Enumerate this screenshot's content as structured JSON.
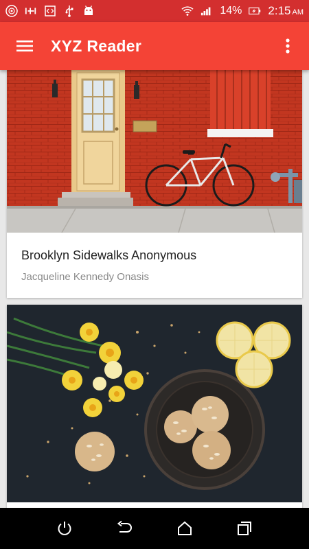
{
  "status_bar": {
    "battery_percent": "14%",
    "time": "2:15",
    "ampm": "AM",
    "icons": [
      "app-badge-icon",
      "signal-bars-icon",
      "code-icon",
      "usb-icon",
      "android-icon",
      "wifi-icon",
      "cell-signal-icon",
      "battery-charging-icon"
    ]
  },
  "app_bar": {
    "title": "XYZ Reader",
    "menu_icon": "hamburger-menu-icon",
    "overflow_icon": "more-vert-icon"
  },
  "articles": [
    {
      "title": "Brooklyn Sidewalks Anonymous",
      "author": "Jacqueline Kennedy Onasis",
      "image": "red brick wall with door and bicycle"
    },
    {
      "title": "",
      "author": "",
      "image": "daffodils, lemons and cookies on dark table"
    }
  ],
  "nav_bar": {
    "icons": [
      "power-icon",
      "back-icon",
      "home-icon",
      "recents-icon"
    ]
  },
  "colors": {
    "status_bar": "#d32f2f",
    "app_bar": "#f44336",
    "background": "#e8e8e8"
  }
}
